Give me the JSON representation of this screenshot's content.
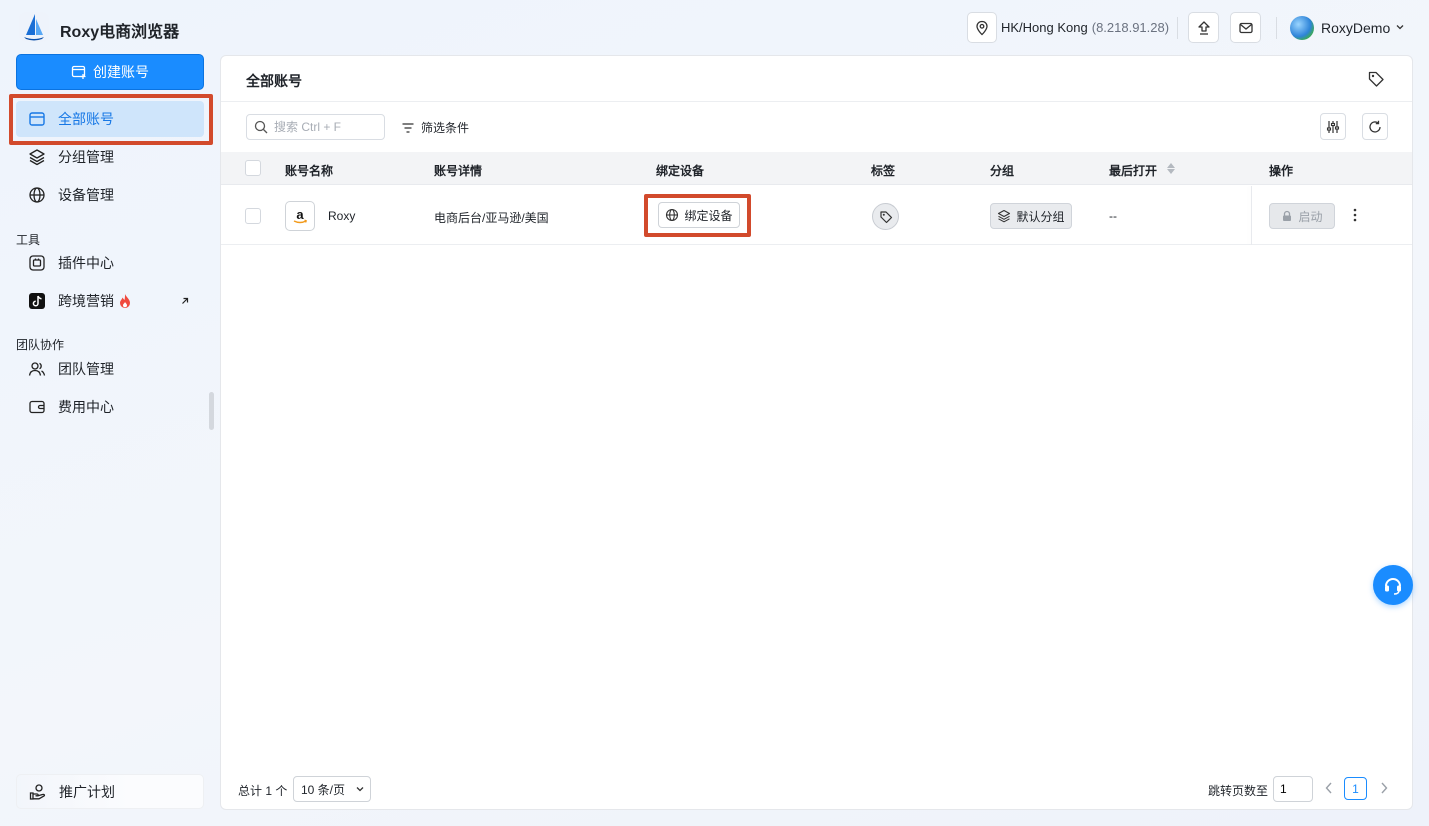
{
  "app": {
    "title": "Roxy电商浏览器"
  },
  "header": {
    "location": "HK/Hong Kong",
    "ip": "(8.218.91.28)",
    "user": "RoxyDemo"
  },
  "sidebar": {
    "create_label": "创建账号",
    "items": [
      {
        "label": "全部账号"
      },
      {
        "label": "分组管理"
      },
      {
        "label": "设备管理"
      }
    ],
    "tools_label": "工具",
    "tools": [
      {
        "label": "插件中心"
      },
      {
        "label": "跨境营销"
      }
    ],
    "team_label": "团队协作",
    "team": [
      {
        "label": "团队管理"
      },
      {
        "label": "费用中心"
      }
    ],
    "promo_label": "推广计划"
  },
  "main": {
    "title": "全部账号",
    "search_placeholder": "搜索 Ctrl + F",
    "filter_label": "筛选条件",
    "columns": [
      "账号名称",
      "账号详情",
      "绑定设备",
      "标签",
      "分组",
      "最后打开",
      "操作"
    ],
    "rows": [
      {
        "name": "Roxy",
        "detail": "电商后台/亚马逊/美国",
        "bind_label": "绑定设备",
        "group": "默认分组",
        "last_open": "--",
        "start_label": "启动"
      }
    ]
  },
  "pagination": {
    "total": "总计 1 个",
    "page_size": "10 条/页",
    "jump_label": "跳转页数至",
    "jump_value": "1",
    "current_page": "1"
  },
  "colors": {
    "accent": "#1a8cff",
    "highlight_box": "#d24a2c",
    "active_bg": "#cfe5fb"
  }
}
